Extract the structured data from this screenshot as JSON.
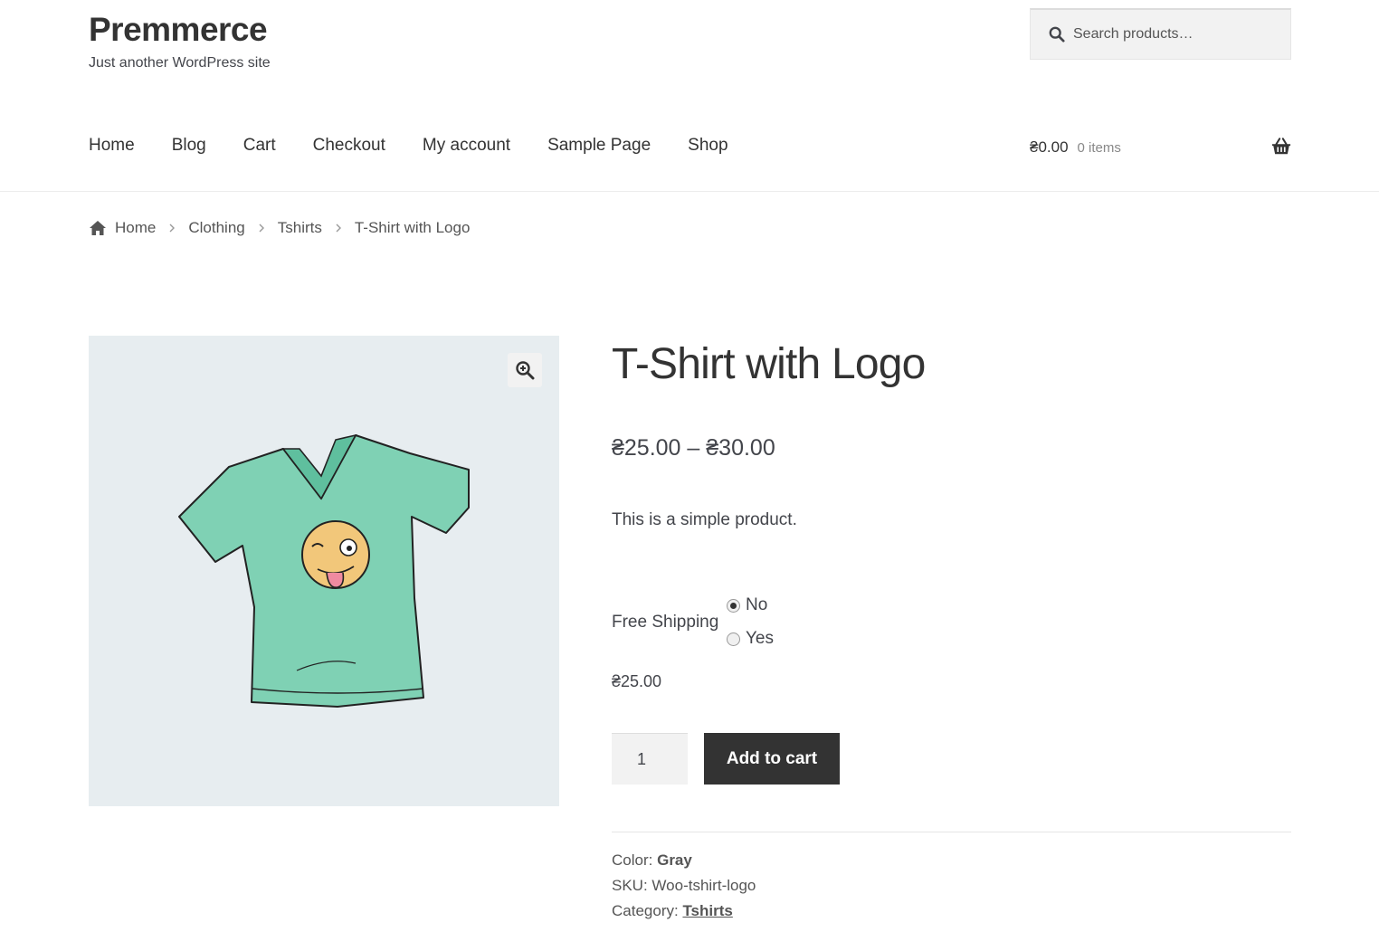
{
  "site": {
    "title": "Premmerce",
    "description": "Just another WordPress site"
  },
  "search": {
    "placeholder": "Search products…"
  },
  "nav": {
    "items": [
      "Home",
      "Blog",
      "Cart",
      "Checkout",
      "My account",
      "Sample Page",
      "Shop"
    ]
  },
  "cart": {
    "amount": "₴0.00",
    "count": "0 items"
  },
  "breadcrumb": {
    "home": "Home",
    "items": [
      "Clothing",
      "Tshirts",
      "T-Shirt with Logo"
    ]
  },
  "product": {
    "title": "T-Shirt with Logo",
    "price_range": "₴25.00 – ₴30.00",
    "short_description": "This is a simple product.",
    "option": {
      "label": "Free Shipping",
      "choices": [
        "No",
        "Yes"
      ],
      "selected": "No"
    },
    "variation_price": "₴25.00",
    "quantity": "1",
    "add_to_cart_label": "Add to cart",
    "meta": {
      "color_label": "Color:",
      "color_value": "Gray",
      "sku_label": "SKU:",
      "sku_value": "Woo-tshirt-logo",
      "category_label": "Category:",
      "category_value": "Tshirts"
    }
  },
  "colors": {
    "header_text": "#333333",
    "button_bg": "#333333",
    "gallery_bg": "#e7edf0",
    "shirt": "#7fd1b4"
  }
}
